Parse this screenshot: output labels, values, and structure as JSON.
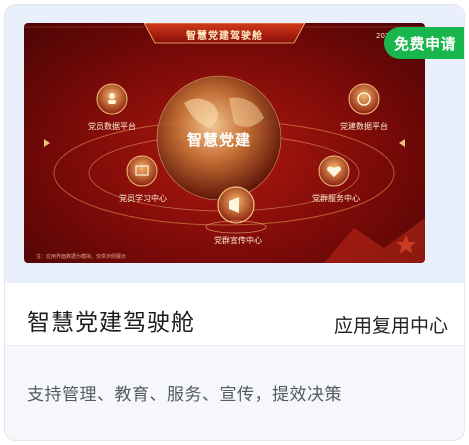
{
  "card": {
    "badge": "免费申请",
    "title": "智慧党建驾驶舱",
    "category": "应用复用中心",
    "description": "支持管理、教育、服务、宣传，提效决策"
  },
  "preview": {
    "header_title": "智慧党建驾驶舱",
    "year_text": "2024",
    "globe_title": "智慧党建",
    "nodes": {
      "left_top": "党员数据平台",
      "right_top": "党建数据平台",
      "left_bottom": "党员学习中心",
      "right_bottom": "党群服务中心",
      "center_bottom": "党群宣传中心"
    },
    "footnote": "注：应用界面数据为模拟，仅供示例展示"
  },
  "colors": {
    "badge_green": "#19b64e",
    "dashboard_red": "#8e0d0a",
    "gold": "#f1c27a"
  }
}
